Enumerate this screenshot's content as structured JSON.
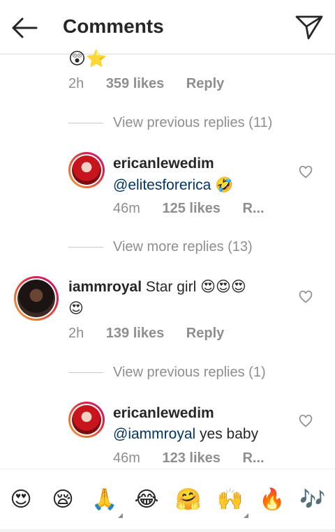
{
  "header": {
    "title": "Comments",
    "back_icon": "arrow-left-icon",
    "send_icon": "paper-plane-icon"
  },
  "top_comment_tail": {
    "emojis": "😲⭐",
    "time": "2h",
    "likes": "359 likes",
    "reply": "Reply"
  },
  "view_previous_1": "View previous replies (11)",
  "reply_1": {
    "username": "ericanlewedim",
    "mention": "@elitesforerica",
    "emoji": "🤣",
    "time": "46m",
    "likes": "125 likes",
    "reply": "R..."
  },
  "view_more": "View more replies (13)",
  "comment_2": {
    "username": "iammroyal",
    "text": "Star girl",
    "emojis": "😍😍😍",
    "emojis_line2": "😍",
    "time": "2h",
    "likes": "139 likes",
    "reply": "Reply"
  },
  "view_previous_2": "View previous replies (1)",
  "reply_2": {
    "username": "ericanlewedim",
    "mention": "@iammroyal",
    "text": "yes baby",
    "time": "46m",
    "likes": "123 likes",
    "reply": "R..."
  },
  "emoji_bar": [
    "😍",
    "😪",
    "🙏",
    "😂",
    "🤗",
    "🙌",
    "🔥",
    "🎶"
  ],
  "colors": {
    "mention": "#003569",
    "muted": "#8e8e8e",
    "text": "#262626"
  }
}
